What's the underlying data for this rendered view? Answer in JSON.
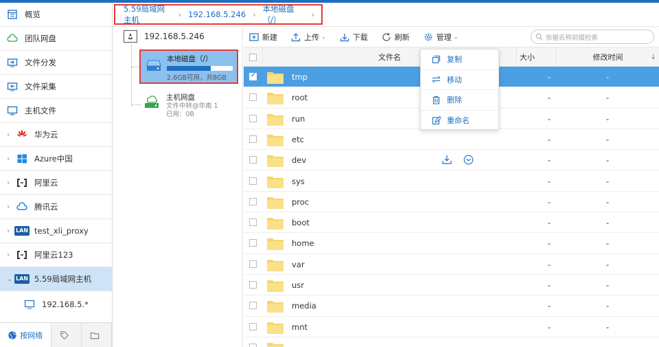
{
  "sidebar": {
    "items": [
      {
        "label": "概览",
        "icon": "overview-icon"
      },
      {
        "label": "团队网盘",
        "icon": "cloud-drive-icon"
      },
      {
        "label": "文件分发",
        "icon": "distribute-icon"
      },
      {
        "label": "文件采集",
        "icon": "collect-icon"
      },
      {
        "label": "主机文件",
        "icon": "host-file-icon"
      },
      {
        "label": "华为云",
        "icon": "huawei-icon"
      },
      {
        "label": "Azure中国",
        "icon": "windows-icon"
      },
      {
        "label": "阿里云",
        "icon": "aliyun-icon"
      },
      {
        "label": "腾讯云",
        "icon": "tencent-cloud-icon"
      },
      {
        "label": "test_xli_proxy",
        "icon": "lan-icon"
      },
      {
        "label": "阿里云123",
        "icon": "aliyun-icon"
      },
      {
        "label": "5.59局域网主机",
        "icon": "lan-icon"
      }
    ],
    "child": {
      "label": "192.168.5.*"
    },
    "lan_badge": "LAN",
    "bottom_tabs": {
      "network": "按网络"
    }
  },
  "breadcrumb": {
    "items": [
      "5.59局域网主机",
      "192.168.5.246",
      "本地磁盘（/）"
    ],
    "separator": "›"
  },
  "tree": {
    "root": "192.168.5.246",
    "local_disk": {
      "name": "本地磁盘（/）",
      "info": "2.6GB可用，共8GB",
      "used_fraction": 0.67
    },
    "cloud_disk": {
      "name": "主机网盘",
      "info1": "文件中转@华南 1",
      "info2": "已用：0B"
    }
  },
  "toolbar": {
    "new": "新建",
    "upload": "上传",
    "download": "下载",
    "refresh": "刷新",
    "manage": "管理",
    "search_placeholder": "依据名称前缀检索"
  },
  "table": {
    "headers": {
      "name": "文件名",
      "size": "大小",
      "mtime": "修改时间"
    },
    "rows": [
      {
        "name": "tmp",
        "size": "-",
        "mtime": "-",
        "selected": true
      },
      {
        "name": "root",
        "size": "-",
        "mtime": "-"
      },
      {
        "name": "run",
        "size": "-",
        "mtime": "-"
      },
      {
        "name": "etc",
        "size": "-",
        "mtime": "-"
      },
      {
        "name": "dev",
        "size": "-",
        "mtime": "-"
      },
      {
        "name": "sys",
        "size": "-",
        "mtime": "-"
      },
      {
        "name": "proc",
        "size": "-",
        "mtime": "-"
      },
      {
        "name": "boot",
        "size": "-",
        "mtime": "-"
      },
      {
        "name": "home",
        "size": "-",
        "mtime": "-"
      },
      {
        "name": "var",
        "size": "-",
        "mtime": "-"
      },
      {
        "name": "usr",
        "size": "-",
        "mtime": "-"
      },
      {
        "name": "media",
        "size": "-",
        "mtime": "-"
      },
      {
        "name": "mnt",
        "size": "-",
        "mtime": "-"
      },
      {
        "name": "",
        "size": "",
        "mtime": ""
      }
    ]
  },
  "context_menu": {
    "copy": "复制",
    "move": "移动",
    "delete": "删除",
    "rename": "重命名"
  },
  "colors": {
    "accent": "#1e6fc2",
    "selected_row": "#4d9fe3",
    "highlight_border": "#e53935",
    "folder": "#f9d46a"
  }
}
